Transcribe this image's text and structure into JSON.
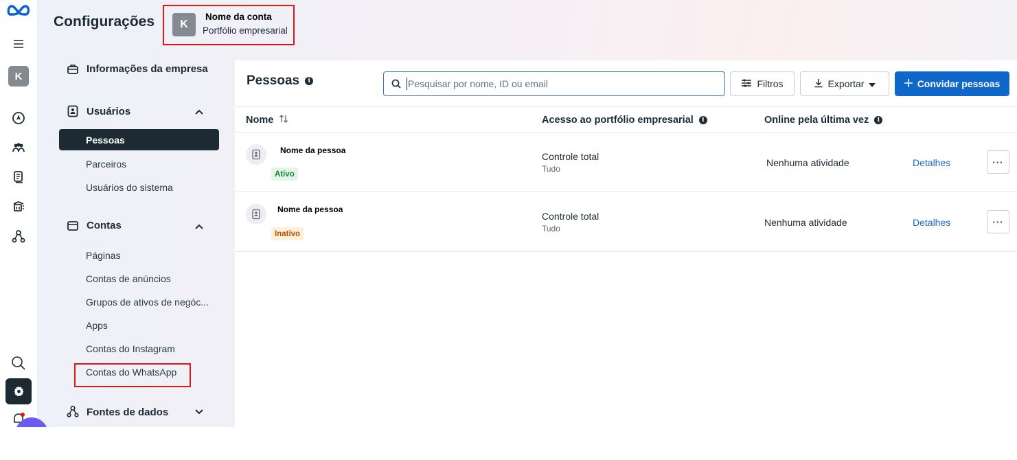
{
  "app": {
    "title": "Configurações"
  },
  "account": {
    "avatar_letter": "K",
    "name": "Nome da conta",
    "subtitle": "Portfólio empresarial"
  },
  "rail": {
    "items": [
      {
        "icon": "meta-logo-icon"
      },
      {
        "icon": "menu-icon"
      },
      {
        "icon": "account-avatar",
        "letter": "K"
      },
      {
        "icon": "compass-icon"
      },
      {
        "icon": "people-icon"
      },
      {
        "icon": "documents-icon"
      },
      {
        "icon": "catalog-icon"
      },
      {
        "icon": "data-sources-icon"
      },
      {
        "icon": "search-icon"
      },
      {
        "icon": "gear-icon"
      },
      {
        "icon": "notification-icon"
      }
    ]
  },
  "sidebar": {
    "company_info": "Informações da empresa",
    "users": {
      "label": "Usuários",
      "items": [
        "Pessoas",
        "Parceiros",
        "Usuários do sistema"
      ]
    },
    "accounts": {
      "label": "Contas",
      "items": [
        "Páginas",
        "Contas de anúncios",
        "Grupos de ativos de negóc...",
        "Apps",
        "Contas do Instagram",
        "Contas do WhatsApp"
      ]
    },
    "data_sources": {
      "label": "Fontes de dados"
    }
  },
  "main": {
    "title": "Pessoas",
    "search_placeholder": "Pesquisar por nome, ID ou email",
    "filters_label": "Filtros",
    "export_label": "Exportar",
    "invite_label": "Convidar pessoas",
    "columns": {
      "name": "Nome",
      "access": "Acesso ao portfólio empresarial",
      "online": "Online pela última vez"
    },
    "rows": [
      {
        "name": "Nome da pessoa",
        "status": "Ativo",
        "access": "Controle total",
        "access_sub": "Tudo",
        "online": "Nenhuma atividade",
        "details": "Detalhes"
      },
      {
        "name": "Nome da pessoa",
        "status": "Inativo",
        "access": "Controle total",
        "access_sub": "Tudo",
        "online": "Nenhuma atividade",
        "details": "Detalhes"
      }
    ]
  },
  "colors": {
    "accent": "#0f68c9",
    "dark": "#1c2b33",
    "highlight_border": "#e0161b",
    "badge_active": "#1a7f37",
    "badge_inactive": "#b45309"
  }
}
